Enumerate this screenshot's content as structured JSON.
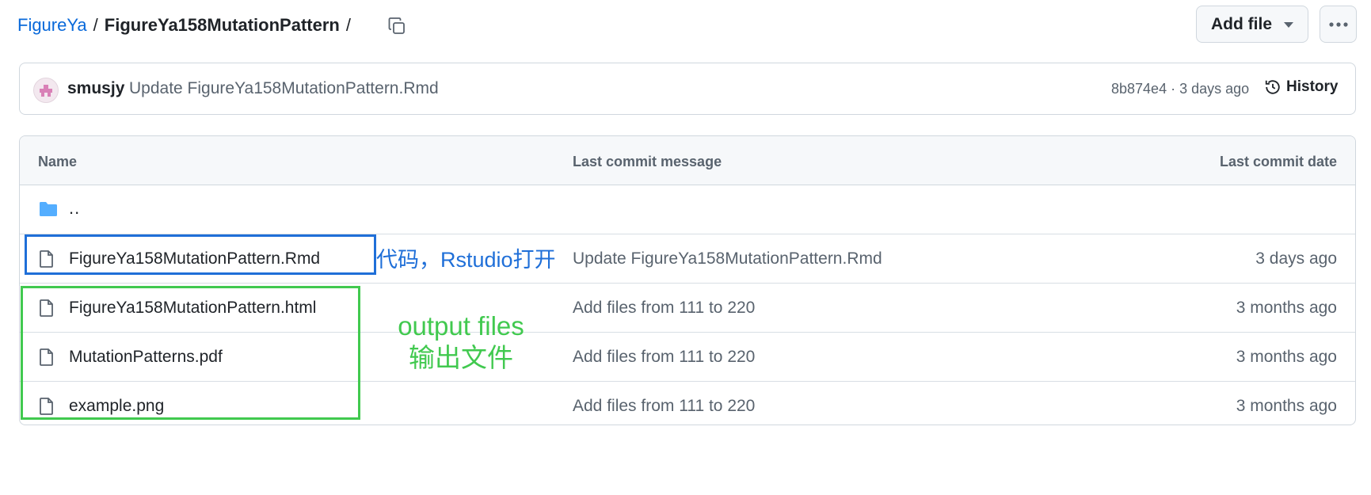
{
  "breadcrumb": {
    "root": "FigureYa",
    "separator": "/",
    "current": "FigureYa158MutationPattern",
    "trailing_separator": "/"
  },
  "header": {
    "add_file_label": "Add file",
    "more_icon": "kebab-horizontal-icon",
    "copy_icon": "copy-icon"
  },
  "commit": {
    "author": "smusjy",
    "message": "Update FigureYa158MutationPattern.Rmd",
    "meta": "8b874e4 · 3 days ago",
    "history_label": "History"
  },
  "table": {
    "headers": {
      "name": "Name",
      "message": "Last commit message",
      "date": "Last commit date"
    },
    "parent": "..",
    "rows": [
      {
        "name": "FigureYa158MutationPattern.Rmd",
        "message": "Update FigureYa158MutationPattern.Rmd",
        "date": "3 days ago"
      },
      {
        "name": "FigureYa158MutationPattern.html",
        "message": "Add files from 111 to 220",
        "date": "3 months ago"
      },
      {
        "name": "MutationPatterns.pdf",
        "message": "Add files from 111 to 220",
        "date": "3 months ago"
      },
      {
        "name": "example.png",
        "message": "Add files from 111 to 220",
        "date": "3 months ago"
      }
    ]
  },
  "annotations": {
    "code_note": "代码，Rstudio打开",
    "output_line1": "output files",
    "output_line2": "输出文件",
    "colors": {
      "blue": "#1f6fd8",
      "green": "#41c94f"
    }
  },
  "colors": {
    "link": "#0969da",
    "muted": "#59636e",
    "border": "#d0d7de",
    "folder": "#54aeff"
  }
}
